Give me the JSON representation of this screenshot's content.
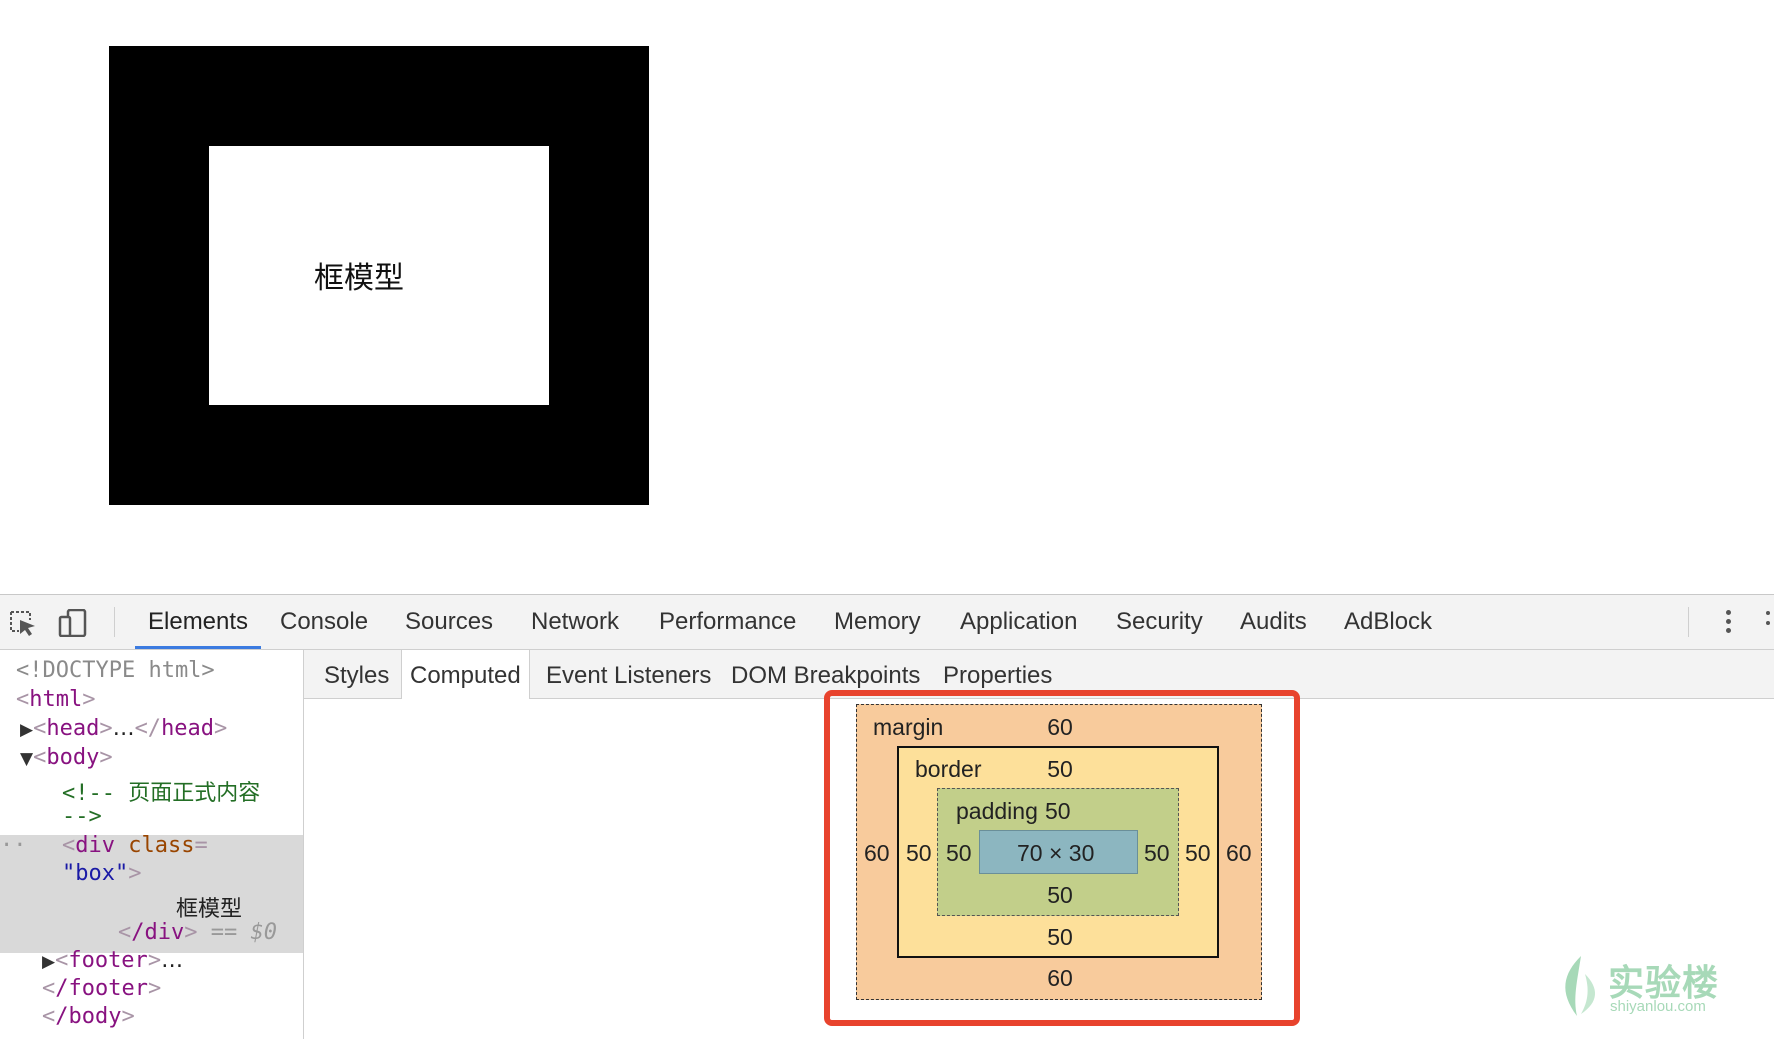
{
  "page": {
    "box_text": "框模型"
  },
  "devtools": {
    "tabs": [
      "Elements",
      "Console",
      "Sources",
      "Network",
      "Performance",
      "Memory",
      "Application",
      "Security",
      "Audits",
      "AdBlock"
    ],
    "active_tab": "Elements",
    "icons": {
      "inspect": "inspect-element-icon",
      "device": "device-toolbar-icon",
      "menu": "more-vertical-icon"
    },
    "subtabs": [
      "Styles",
      "Computed",
      "Event Listeners",
      "DOM Breakpoints",
      "Properties"
    ],
    "active_subtab": "Computed",
    "dom_tree": {
      "doctype": "<!DOCTYPE html>",
      "html_open": "html",
      "head": "head",
      "head_ellipsis": "…",
      "body_open": "body",
      "comment_line1": "<!-- 页面正式内容",
      "comment_line2": "-->",
      "div_tag": "div",
      "div_attr": "class",
      "div_attr_value": "\"box\"",
      "div_text": "框模型",
      "div_close": "/div",
      "selected_marker": "== $0",
      "footer": "footer",
      "footer_ellipsis": "…",
      "footer_close": "/footer",
      "body_close": "/body",
      "row_marker": "··"
    },
    "box_model": {
      "margin_label": "margin",
      "border_label": "border",
      "padding_label": "padding",
      "margin": {
        "top": "60",
        "right": "60",
        "bottom": "60",
        "left": "60"
      },
      "border": {
        "top": "50",
        "right": "50",
        "bottom": "50",
        "left": "50"
      },
      "padding": {
        "top": "50",
        "right": "50",
        "bottom": "50",
        "left": "50"
      },
      "content": "70 × 30",
      "colors": {
        "margin": "#f8cb9c",
        "border": "#fde09a",
        "padding": "#c2cf8a",
        "content": "#8cb6c0",
        "highlight": "#e8432d"
      }
    }
  },
  "watermark": {
    "text": "实验楼",
    "sub": "shiyanlou.com"
  }
}
